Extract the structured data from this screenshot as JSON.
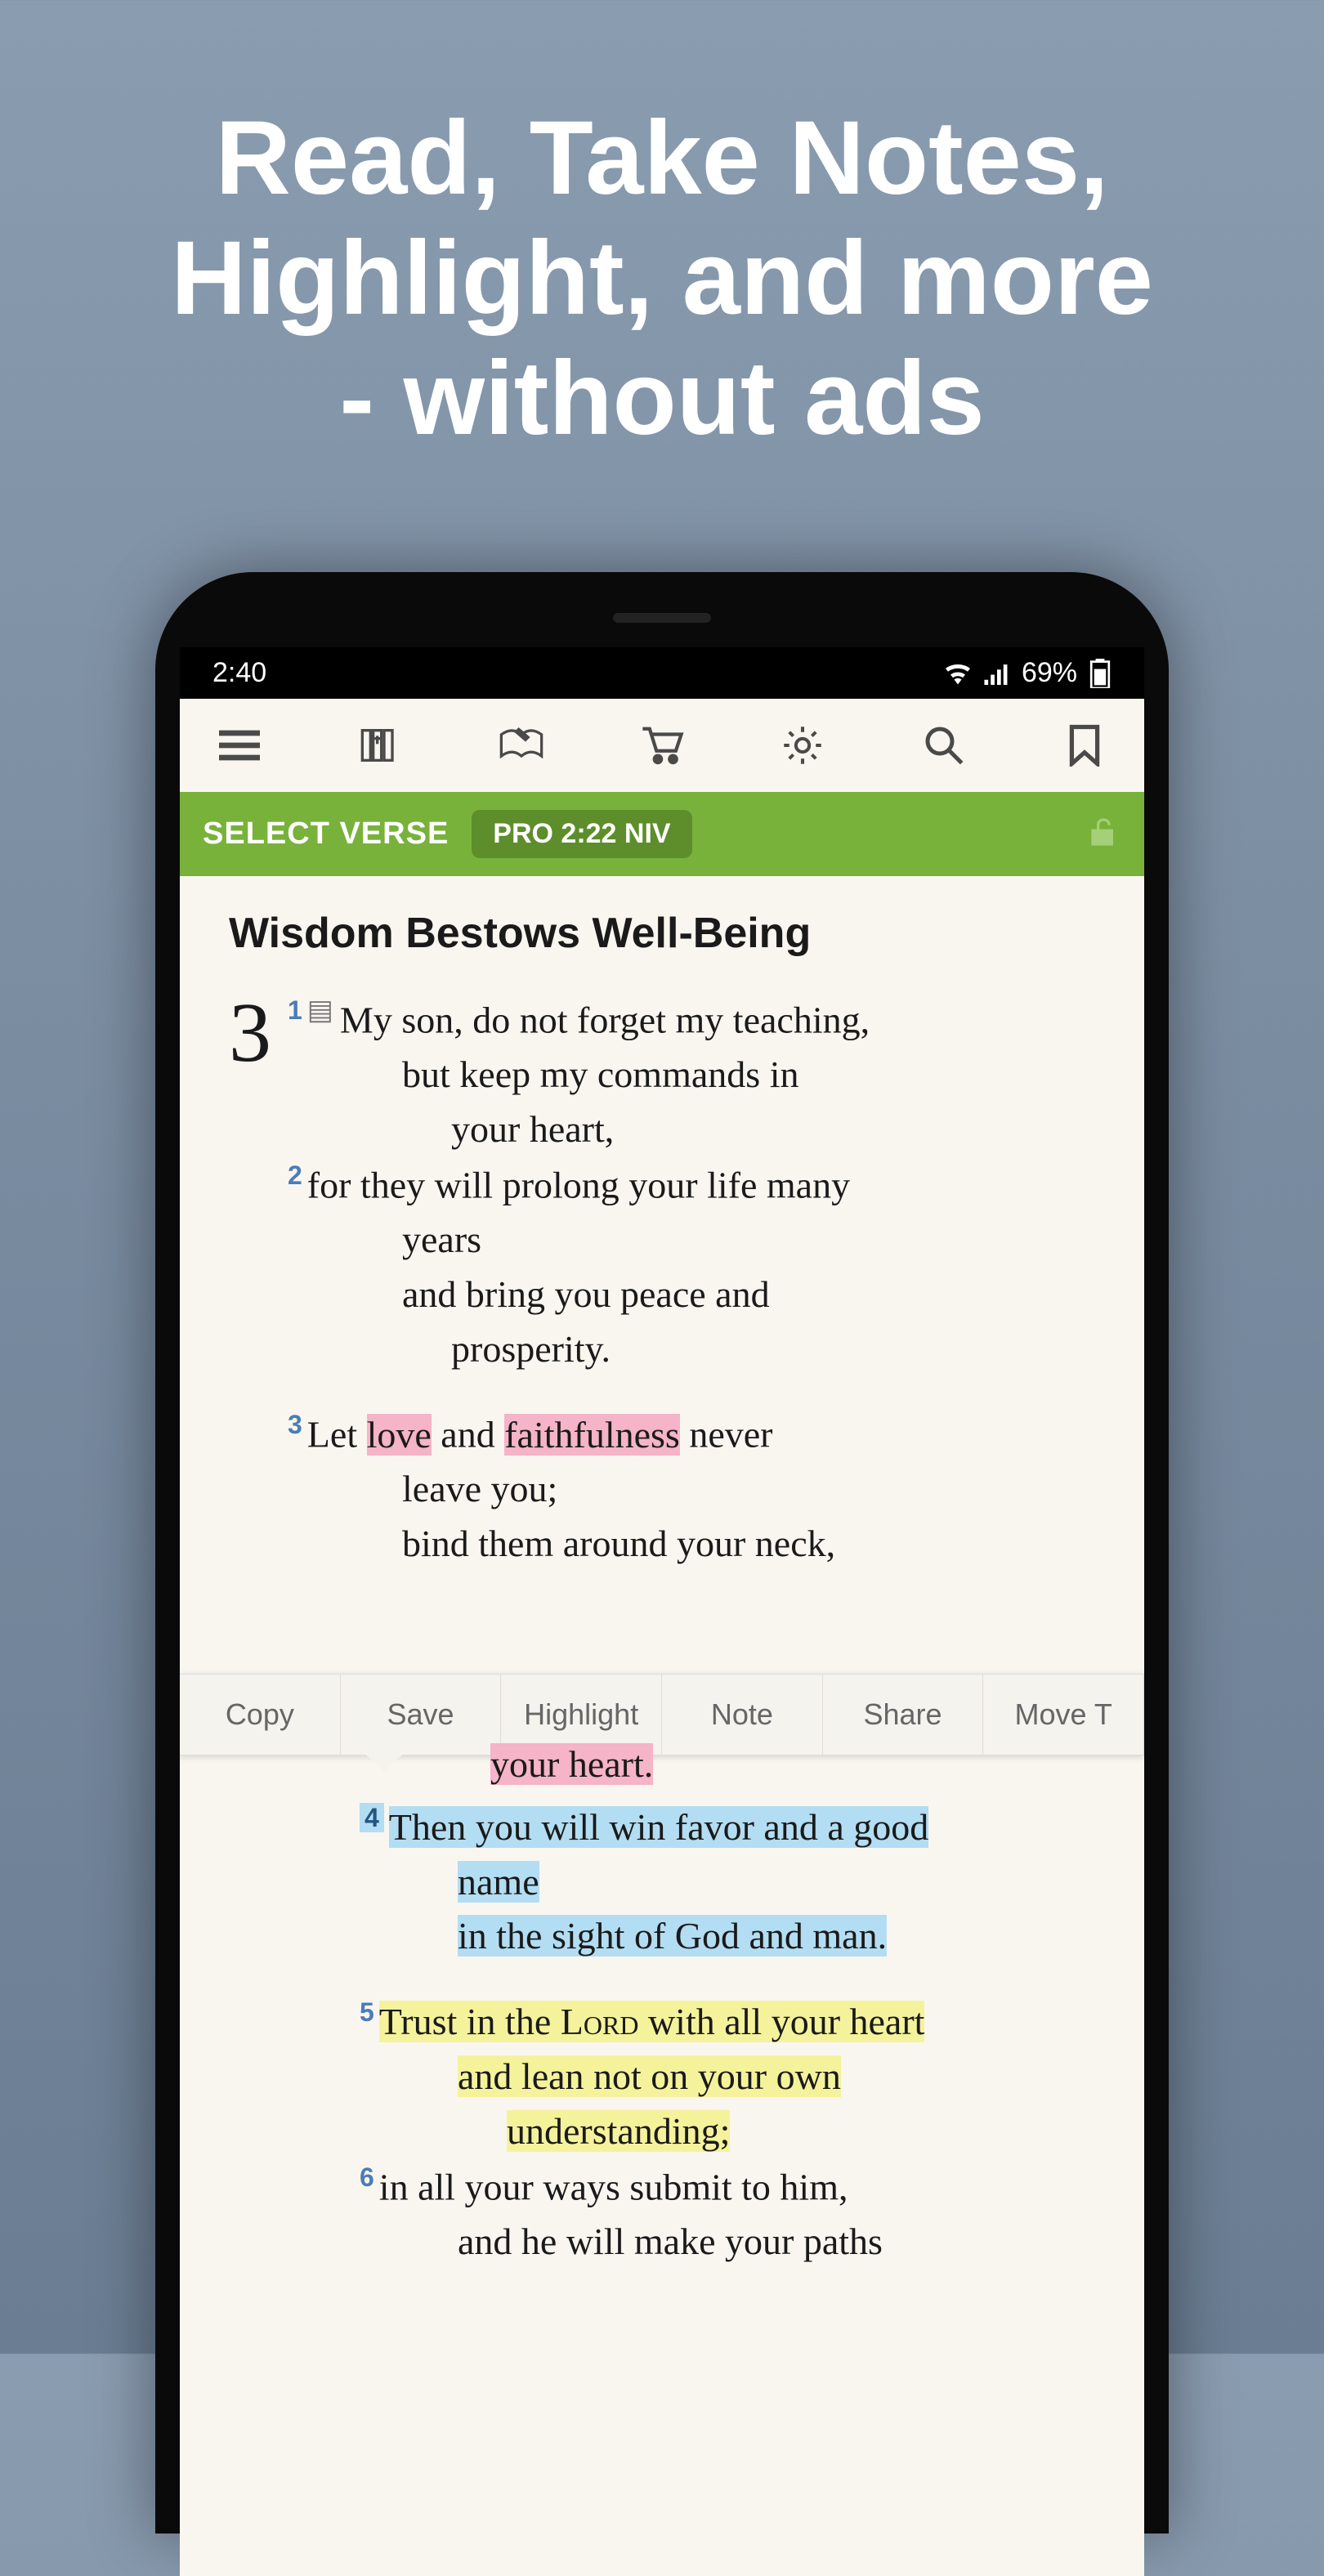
{
  "hero": {
    "line1": "Read, Take Notes,",
    "line2": "Highlight, and more",
    "line3": "- without ads"
  },
  "status": {
    "time": "2:40",
    "battery": "69%"
  },
  "verse_bar": {
    "label": "SELECT VERSE",
    "ref": "PRO 2:22 NIV"
  },
  "content": {
    "chapter_title": "Wisdom Bestows Well-Being",
    "chapter_number": "3",
    "verses": {
      "v1_line1": "My son, do not forget my teaching,",
      "v1_line2": "but keep my commands in",
      "v1_line2b": "your heart,",
      "v2_line1": "for they will prolong your life many",
      "v2_line1b": "years",
      "v2_line2": "and bring you peace and",
      "v2_line2b": "prosperity.",
      "v3_pre": "Let ",
      "v3_love": "love",
      "v3_and": " and ",
      "v3_faith": "faithfulness",
      "v3_post": " never",
      "v3_line1b": "leave you;",
      "v3_line2": "bind them around your neck,",
      "v3_line3": "your heart.",
      "v4_line1": "Then you will win favor and a good",
      "v4_line1b": "name",
      "v4_line2": "in the sight of God and man.",
      "v5_line1a": "Trust in the ",
      "v5_lord": "Lord",
      "v5_line1b": " with all your heart",
      "v5_line2": "and lean not on your own",
      "v5_line2b": "understanding;",
      "v6_line1": "in all your ways submit to him,",
      "v6_line2": "and he will make your paths"
    }
  },
  "actions": {
    "copy": "Copy",
    "save": "Save",
    "highlight": "Highlight",
    "note": "Note",
    "share": "Share",
    "moveto": "Move T"
  },
  "verse_numbers": {
    "v1": "1",
    "v2": "2",
    "v3": "3",
    "v4": "4",
    "v5": "5",
    "v6": "6"
  }
}
